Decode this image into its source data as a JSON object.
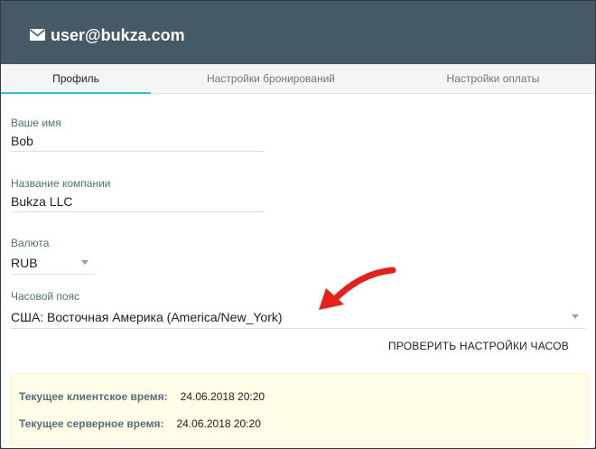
{
  "header": {
    "icon": "mail-icon",
    "email": "user@bukza.com",
    "background": "#455a64"
  },
  "tabs": [
    {
      "label": "Профиль",
      "active": true
    },
    {
      "label": "Настройки бронирований",
      "active": false
    },
    {
      "label": "Настройки оплаты",
      "active": false
    }
  ],
  "accent": "#26c6da",
  "form": {
    "name": {
      "label": "Ваше имя",
      "value": "Bob"
    },
    "company": {
      "label": "Название компании",
      "value": "Bukza LLC"
    },
    "currency": {
      "label": "Валюта",
      "value": "RUB"
    },
    "timezone": {
      "label": "Часовой пояс",
      "value": "США: Восточная Америка (America/New_York)"
    }
  },
  "check_button": "ПРОВЕРИТЬ НАСТРОЙКИ ЧАСОВ",
  "times": {
    "client": {
      "label": "Текущее клиентское время:",
      "value": "24.06.2018 20:20"
    },
    "server": {
      "label": "Текущее серверное время:",
      "value": "24.06.2018 20:20"
    }
  },
  "annotation": {
    "icon": "red-arrow-icon",
    "color": "#e8201c"
  }
}
